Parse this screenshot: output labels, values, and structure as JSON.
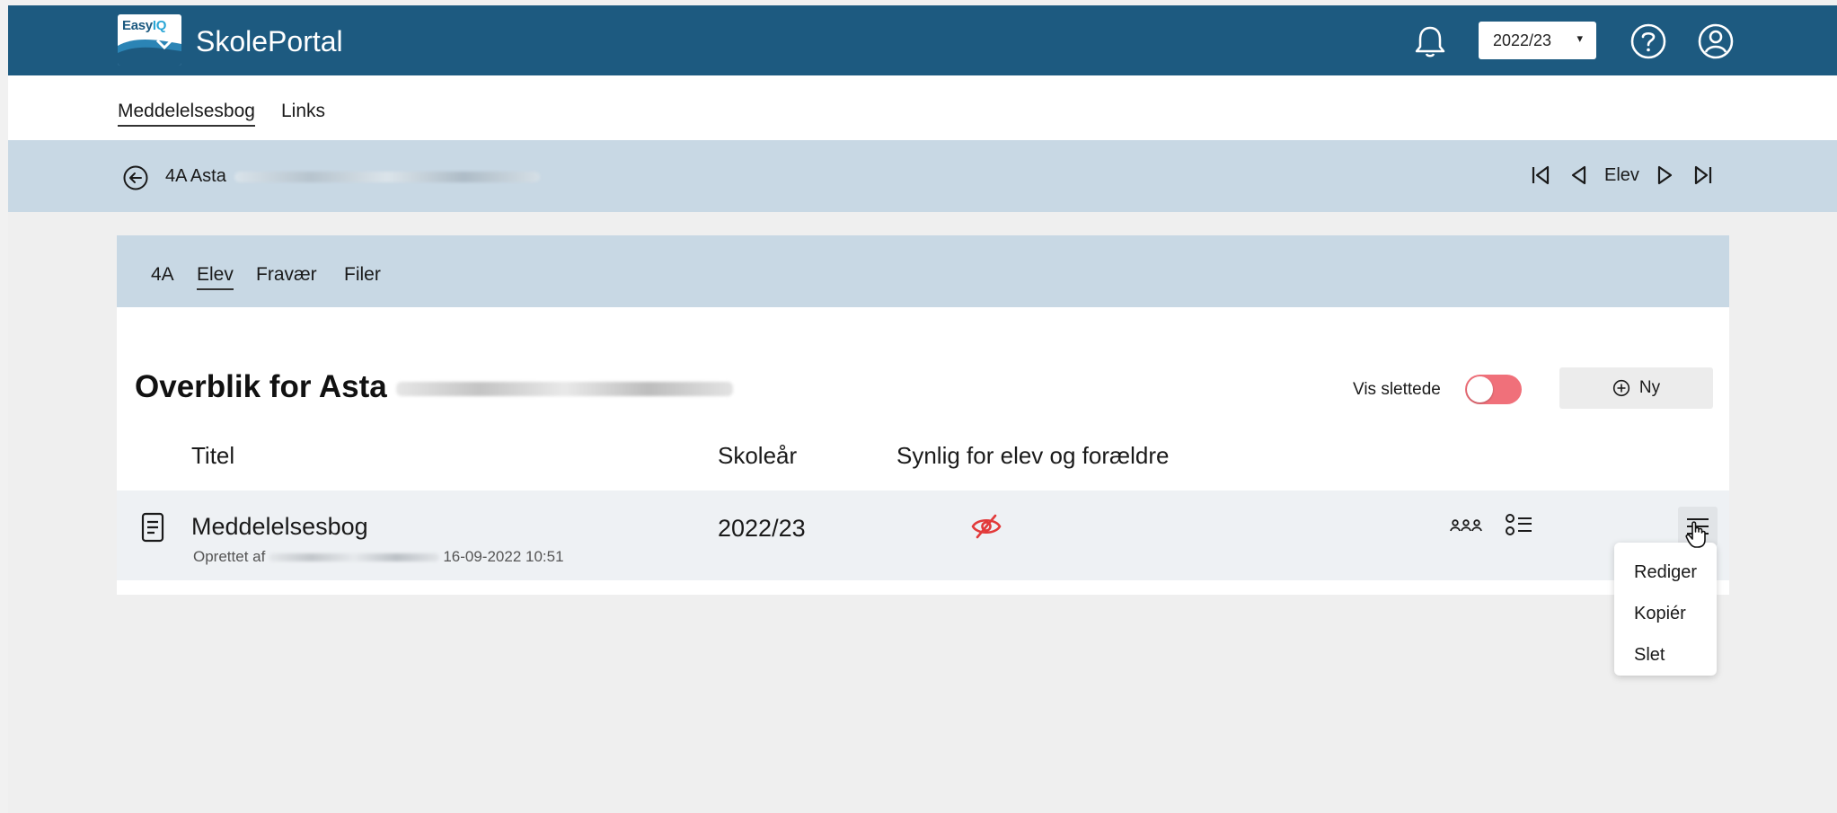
{
  "app": {
    "logo_word": "Easy",
    "logo_iq": "IQ",
    "title": "SkolePortal"
  },
  "header": {
    "year_selected": "2022/23",
    "year_caret": "▾"
  },
  "subnav": {
    "items": [
      "Meddelelsesbog",
      "Links"
    ]
  },
  "breadcrumb": {
    "prefix": "4A Asta",
    "nav_label": "Elev"
  },
  "card_tabs": [
    "4A",
    "Elev",
    "Fravær",
    "Filer"
  ],
  "overview": {
    "title_prefix": "Overblik for Asta",
    "toggle_label": "Vis slettede",
    "new_button": "Ny"
  },
  "table": {
    "headers": [
      "Titel",
      "Skoleår",
      "Synlig for elev og forældre"
    ],
    "rows": [
      {
        "title": "Meddelelsesbog",
        "meta_prefix": "Oprettet af",
        "meta_date": "16-09-2022 10:51",
        "year": "2022/23"
      }
    ]
  },
  "menu": {
    "items": [
      "Rediger",
      "Kopiér",
      "Slet"
    ]
  },
  "colors": {
    "header_bg": "#1d5a80",
    "band_bg": "#c8d8e4",
    "toggle_on": "#f0707a",
    "hidden_icon": "#e23a3a"
  },
  "icons": [
    "bell-icon",
    "help-icon",
    "user-icon",
    "back-arrow-icon",
    "first-icon",
    "prev-icon",
    "next-icon",
    "last-icon",
    "plus-circle-icon",
    "document-icon",
    "eye-slash-icon",
    "users-icon",
    "checklist-icon",
    "menu-icon",
    "hand-cursor-icon"
  ]
}
